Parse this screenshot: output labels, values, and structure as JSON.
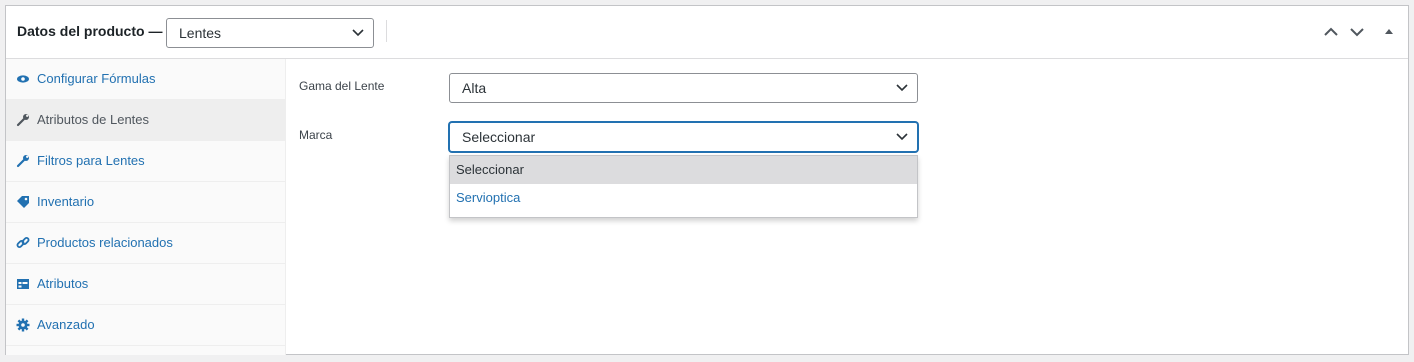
{
  "header": {
    "title": "Datos del producto —",
    "product_type": "Lentes",
    "move_up_label": "move-up",
    "move_down_label": "move-down",
    "toggle_label": "toggle-panel"
  },
  "tabs": [
    {
      "label": "Configurar Fórmulas",
      "icon": "eye-icon"
    },
    {
      "label": "Atributos de Lentes",
      "icon": "wrench-icon",
      "active": true
    },
    {
      "label": "Filtros para Lentes",
      "icon": "wrench-icon"
    },
    {
      "label": "Inventario",
      "icon": "tag-icon"
    },
    {
      "label": "Productos relacionados",
      "icon": "link-icon"
    },
    {
      "label": "Atributos",
      "icon": "table-icon"
    },
    {
      "label": "Avanzado",
      "icon": "gear-icon"
    }
  ],
  "fields": {
    "gama": {
      "label": "Gama del Lente",
      "value": "Alta"
    },
    "marca": {
      "label": "Marca",
      "value": "Seleccionar"
    }
  },
  "marca_options": [
    "Seleccionar",
    "Servioptica"
  ],
  "colors": {
    "link": "#2271b1",
    "border": "#c3c4c7",
    "focus": "#2271b1"
  }
}
